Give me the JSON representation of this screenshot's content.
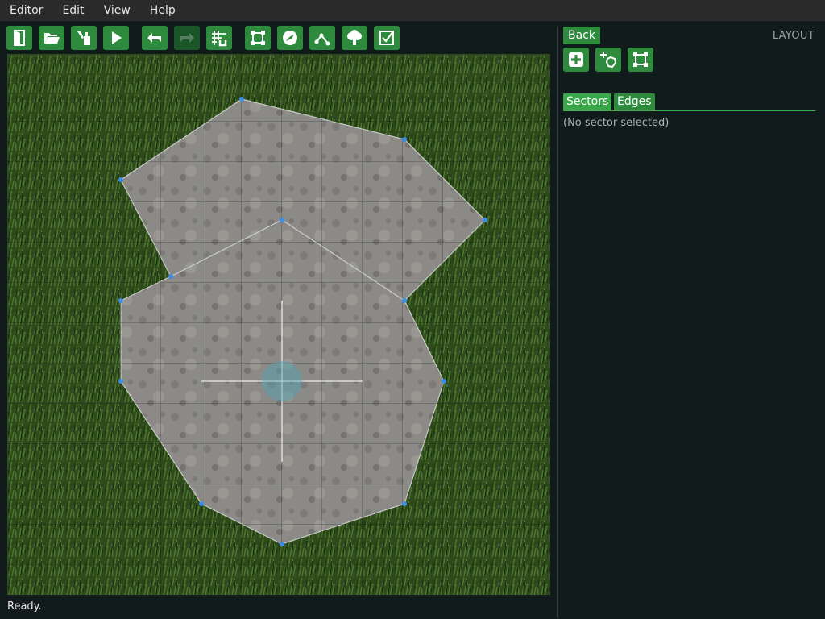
{
  "menubar": {
    "items": [
      {
        "label": "Editor"
      },
      {
        "label": "Edit"
      },
      {
        "label": "View"
      },
      {
        "label": "Help"
      }
    ]
  },
  "toolbar": {
    "buttons": [
      {
        "icon": "door-exit-icon",
        "enabled": true
      },
      {
        "icon": "folder-open-icon",
        "enabled": true
      },
      {
        "icon": "save-icon",
        "enabled": true
      },
      {
        "icon": "play-icon",
        "enabled": true
      },
      {
        "icon": "undo-icon",
        "enabled": true
      },
      {
        "icon": "redo-icon",
        "enabled": false
      },
      {
        "icon": "grid-snap-icon",
        "enabled": true
      },
      {
        "icon": "layout-mode-icon",
        "enabled": true
      },
      {
        "icon": "texture-mode-icon",
        "enabled": true
      },
      {
        "icon": "path-mode-icon",
        "enabled": true
      },
      {
        "icon": "tree-icon",
        "enabled": true
      },
      {
        "icon": "checkbox-icon",
        "enabled": true
      }
    ]
  },
  "panel": {
    "back_label": "Back",
    "mode_label": "LAYOUT",
    "tool_buttons": [
      {
        "icon": "add-sector-icon"
      },
      {
        "icon": "add-circle-sector-icon"
      },
      {
        "icon": "edit-sector-icon"
      }
    ],
    "tabs": [
      {
        "label": "Sectors",
        "active": true
      },
      {
        "label": "Edges",
        "active": false
      }
    ],
    "empty_message": "(No sector selected)"
  },
  "status": {
    "text": "Ready."
  },
  "colors": {
    "accent": "#2e8b3e",
    "vertex": "#3a8ee6",
    "background": "#111b1b"
  }
}
